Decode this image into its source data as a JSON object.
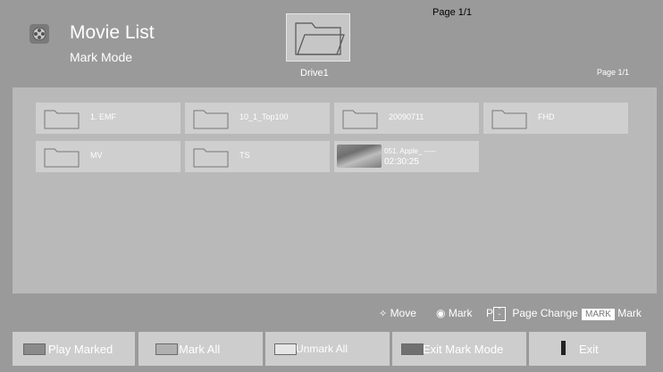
{
  "header": {
    "title": "Movie List",
    "subtitle": "Mark Mode",
    "drive_label": "Drive1",
    "page_top": "Page 1/1",
    "page_right": "Page 1/1"
  },
  "items": [
    {
      "label": "1. EMF",
      "type": "folder"
    },
    {
      "label": "10_1_Top100",
      "type": "folder"
    },
    {
      "label": "20090711",
      "type": "folder"
    },
    {
      "label": "FHD",
      "type": "folder"
    },
    {
      "label": "MV",
      "type": "folder"
    },
    {
      "label": "TS",
      "type": "folder"
    },
    {
      "label": "051. Apple_ -----",
      "duration": "02:30:25",
      "type": "video"
    }
  ],
  "help": {
    "move": "Move",
    "mark": "Mark",
    "page_key": "P",
    "page_change": "Page Change",
    "mark_key": "MARK",
    "mark_label": "Mark"
  },
  "buttons": {
    "play_marked": "Play Marked",
    "mark_all": "Mark All",
    "unmark_all": "Unmark All",
    "exit_mark_mode": "Exit Mark Mode",
    "exit": "Exit"
  },
  "colors": {
    "red_key": "#8a8a8a",
    "green_key": "#b0b0b0",
    "yellow_key": "#e6e6e6",
    "blue_key": "#707070"
  }
}
